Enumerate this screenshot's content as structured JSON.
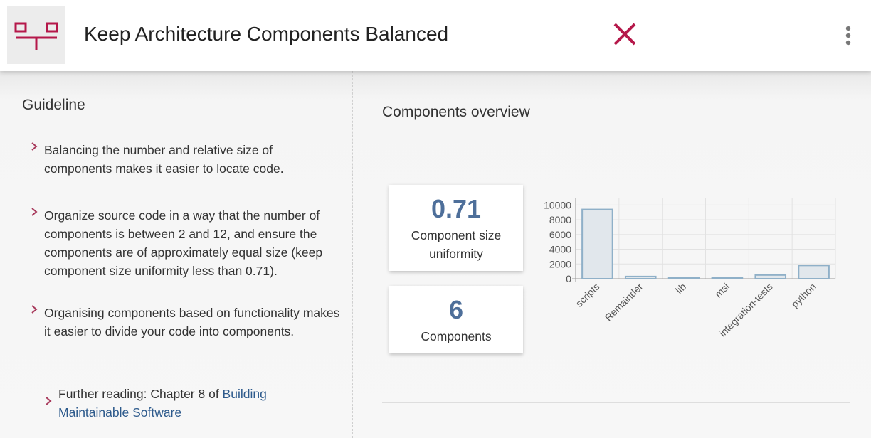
{
  "header": {
    "title": "Keep Architecture Components Balanced",
    "brand_color": "#b5184a",
    "logo_icon": "component-connector-icon",
    "close_icon": "close-icon",
    "menu_icon": "more-vertical-icon"
  },
  "guideline": {
    "heading": "Guideline",
    "items": [
      "Balancing the number and relative size of components makes it easier to locate code.",
      "Organize source code in a way that the number of components is between 2 and 12, and ensure the components are of approximately equal size (keep component size uniformity less than 0.71).",
      "Organising components based on functionality makes it easier to divide your code into components."
    ],
    "further_reading": {
      "prefix": "Further reading: Chapter 8 of ",
      "link_text": "Building Maintainable Software"
    }
  },
  "overview": {
    "heading": "Components overview",
    "uniformity": {
      "value": "0.71",
      "label": "Component size uniformity"
    },
    "components": {
      "value": "6",
      "label": "Components"
    }
  },
  "chart_data": {
    "type": "bar",
    "categories": [
      "scripts",
      "Remainder",
      "lib",
      "msi",
      "integration-tests",
      "python"
    ],
    "values": [
      9400,
      300,
      100,
      100,
      500,
      1800
    ],
    "ylim": [
      0,
      11000
    ],
    "yticks": [
      "10000",
      "8000",
      "6000",
      "4000",
      "2000",
      "0"
    ],
    "grid": true,
    "bar_fill": "#e1e7ec",
    "bar_stroke": "#8fb0c8"
  }
}
